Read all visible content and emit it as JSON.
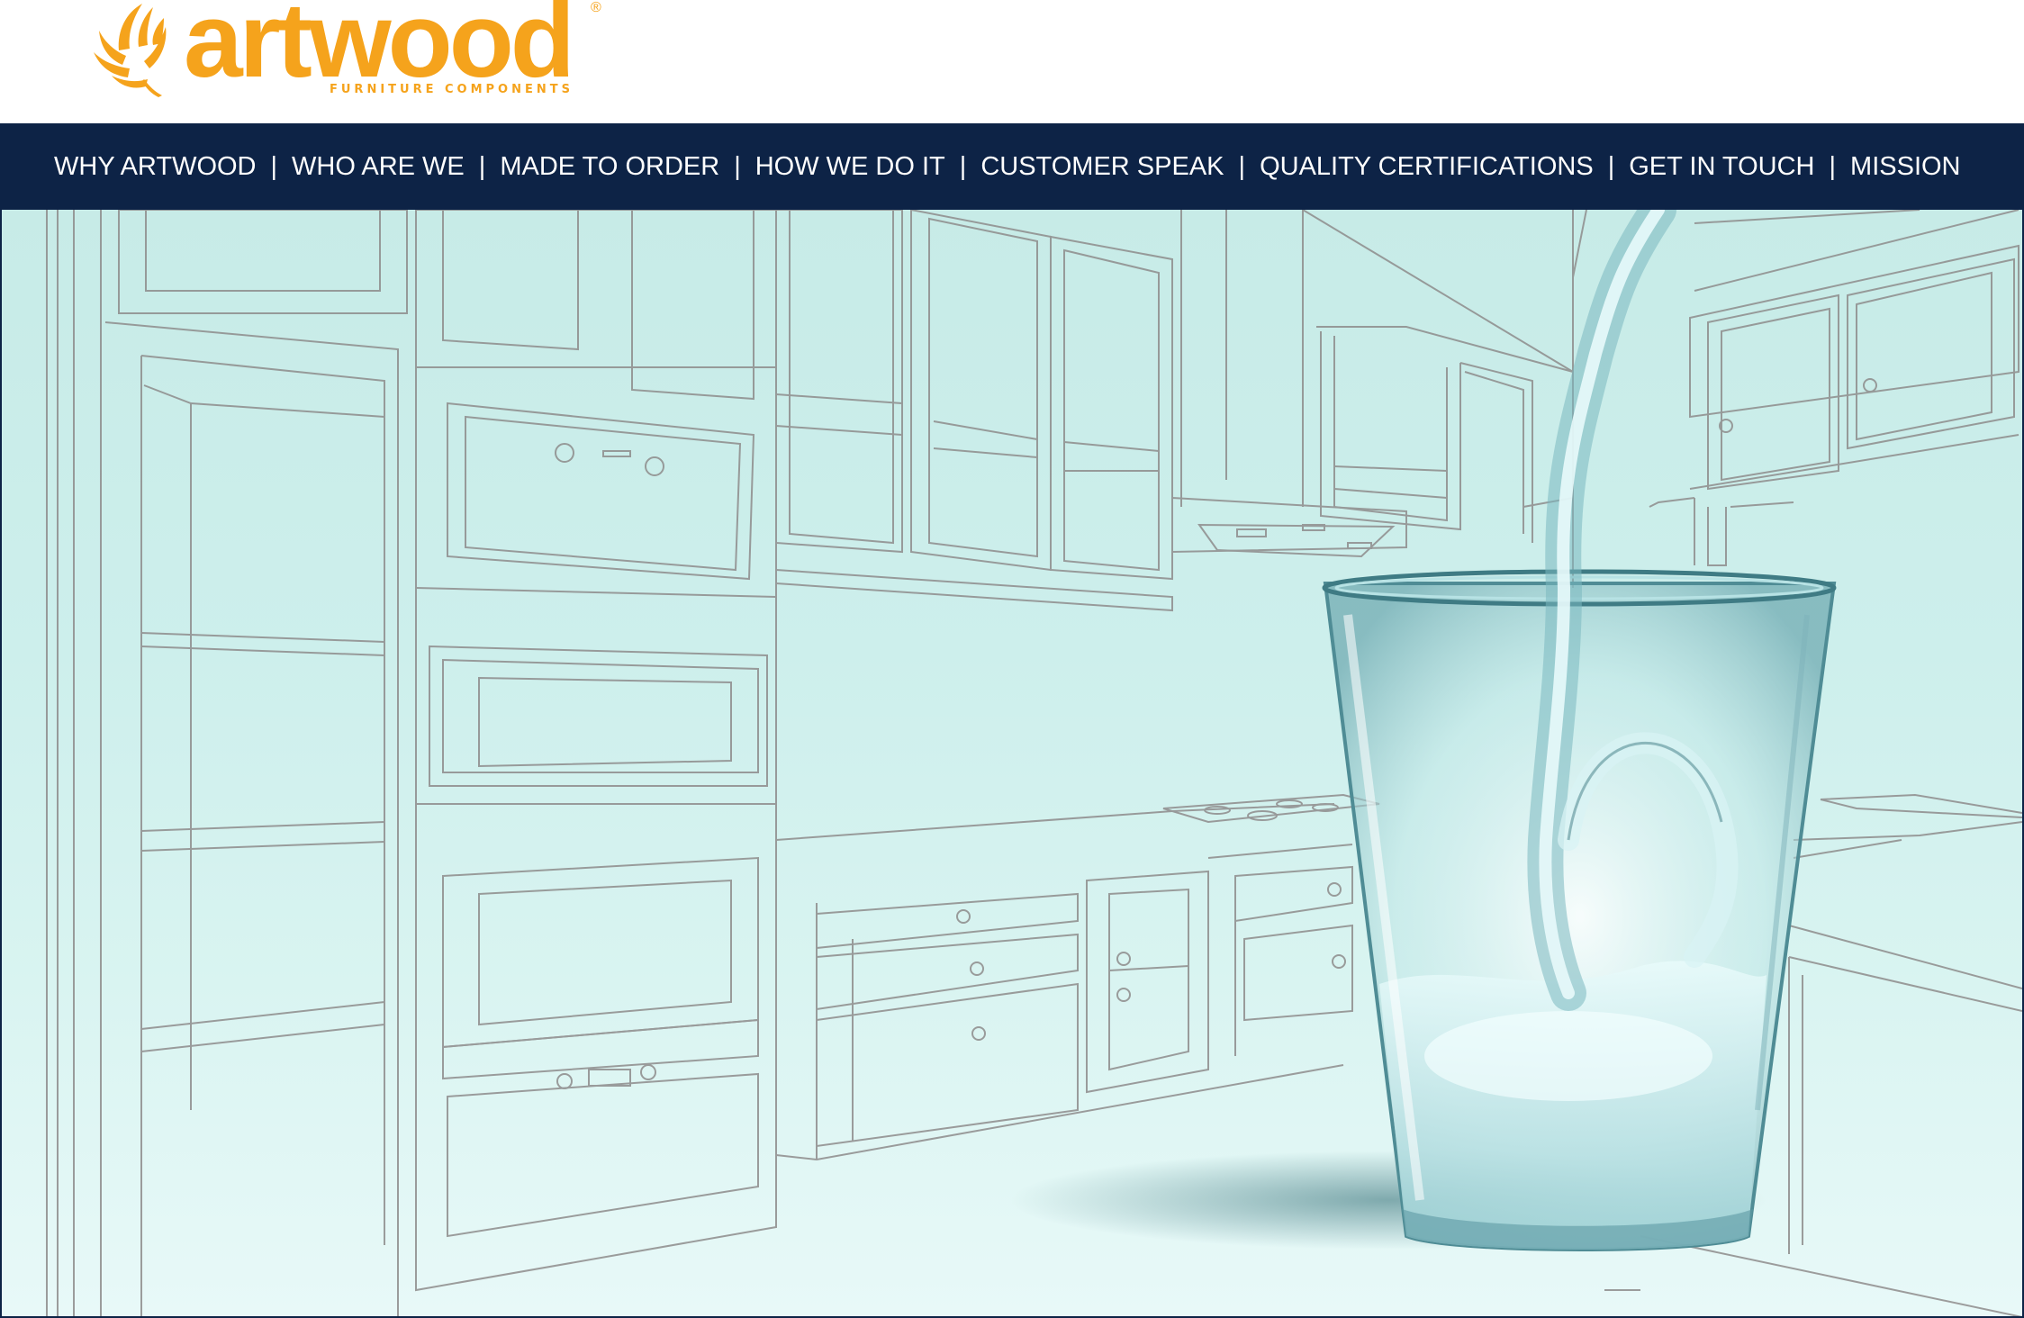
{
  "brand": {
    "name": "artwood",
    "registered_mark": "®",
    "tagline": "FURNITURE COMPONENTS",
    "logo_icon": "leaf-logo-icon",
    "brand_color": "#f5a31c"
  },
  "nav": {
    "background": "#0d2346",
    "separator": "|",
    "items": [
      {
        "label": "WHY ARTWOOD"
      },
      {
        "label": "WHO ARE WE"
      },
      {
        "label": "MADE TO ORDER"
      },
      {
        "label": "HOW WE DO IT"
      },
      {
        "label": "CUSTOMER SPEAK"
      },
      {
        "label": "QUALITY CERTIFICATIONS"
      },
      {
        "label": "GET IN TOUCH"
      },
      {
        "label": "MISSION"
      }
    ]
  },
  "hero": {
    "image": "kitchen-sketch-with-water-glass",
    "tint": "#c7ebe7"
  }
}
